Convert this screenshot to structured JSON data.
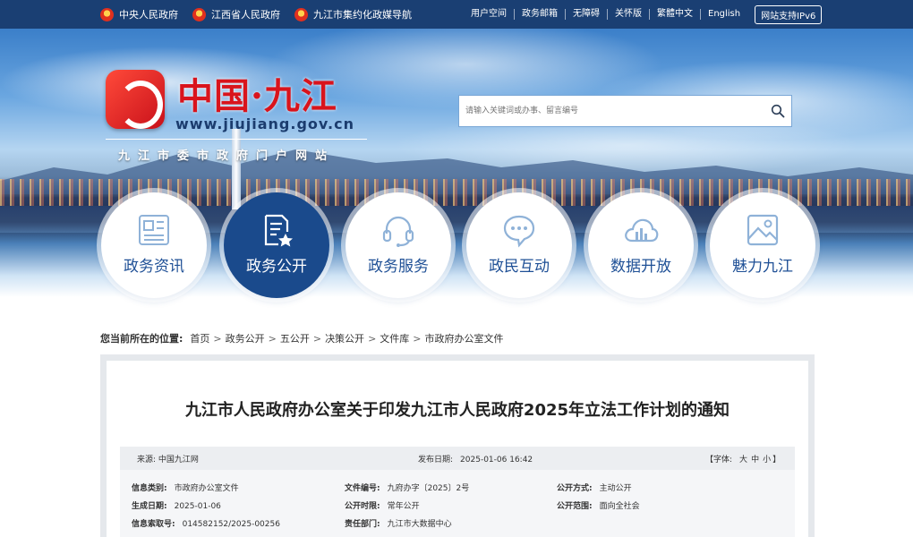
{
  "topbar": {
    "links": [
      "中央人民政府",
      "江西省人民政府",
      "九江市集约化政媒导航"
    ],
    "right_links": [
      "用户空间",
      "政务邮箱",
      "无障碍",
      "关怀版",
      "繁體中文",
      "English"
    ],
    "ipv6": "网站支持IPv6"
  },
  "logo": {
    "title": "中国·九江",
    "url": "www.jiujiang.gov.cn",
    "subtitle": "九江市委市政府门户网站"
  },
  "search": {
    "placeholder": "请输入关键词或办事、留言编号",
    "icon": "search-icon"
  },
  "nav": [
    {
      "label": "政务资讯",
      "icon": "news-icon"
    },
    {
      "label": "政务公开",
      "icon": "document-star-icon"
    },
    {
      "label": "政务服务",
      "icon": "headset-icon"
    },
    {
      "label": "政民互动",
      "icon": "chat-bubble-icon"
    },
    {
      "label": "数据开放",
      "icon": "cloud-chart-icon"
    },
    {
      "label": "魅力九江",
      "icon": "picture-icon"
    }
  ],
  "breadcrumb": {
    "label": "您当前所在的位置:",
    "items": [
      "首页",
      "政务公开",
      "五公开",
      "决策公开",
      "文件库",
      "市政府办公室文件"
    ],
    "separator": ">"
  },
  "article": {
    "title": "九江市人民政府办公室关于印发九江市人民政府2025年立法工作计划的通知",
    "source": "来源:  中国九江网",
    "publish_label": "发布日期:",
    "publish_date": "2025-01-06 16:42",
    "fontsize_label": "【字体:",
    "fontsize_options": [
      "大",
      "中",
      "小"
    ],
    "fontsize_end": "】",
    "meta": {
      "category_label": "信息类别:",
      "category": "市政府办公室文件",
      "docno_label": "文件编号:",
      "docno": "九府办字〔2025〕2号",
      "method_label": "公开方式:",
      "method": "主动公开",
      "date_label": "生成日期:",
      "date": "2025-01-06",
      "period_label": "公开时限:",
      "period": "常年公开",
      "scope_label": "公开范围:",
      "scope": "面向全社会",
      "index_label": "信息索取号:",
      "index": "014582152/2025-00256",
      "dept_label": "责任部门:",
      "dept": "九江市大数据中心"
    }
  },
  "colors": {
    "topbar": "#1a3f73",
    "brand_red": "#d9141c",
    "nav_text": "#1f5096",
    "nav_active": "#1a4a8c"
  }
}
